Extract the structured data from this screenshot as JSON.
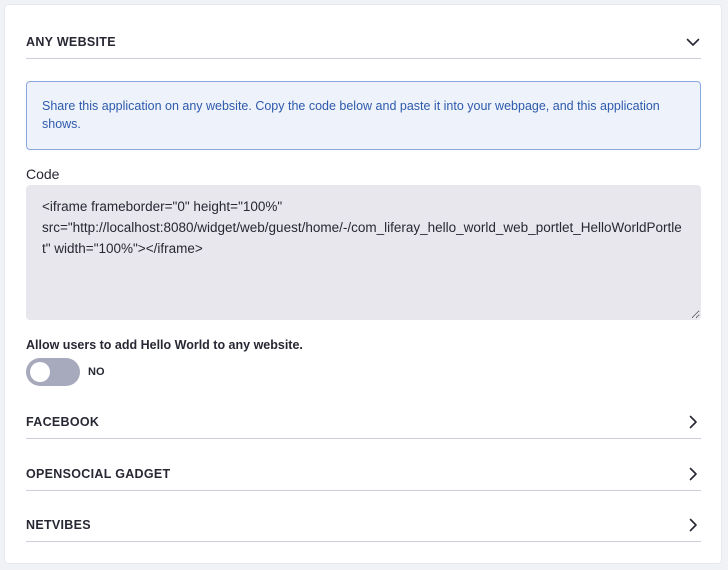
{
  "panels": {
    "any_website": {
      "title": "ANY WEBSITE",
      "icon": "chevron-down-icon",
      "expanded": true
    },
    "facebook": {
      "title": "FACEBOOK",
      "icon": "chevron-right-icon"
    },
    "opensocial": {
      "title": "OPENSOCIAL GADGET",
      "icon": "chevron-right-icon"
    },
    "netvibes": {
      "title": "NETVIBES",
      "icon": "chevron-right-icon"
    }
  },
  "alert": {
    "text": "Share this application on any website. Copy the code below and paste it into your webpage, and this application shows."
  },
  "code": {
    "label": "Code",
    "value": "<iframe frameborder=\"0\" height=\"100%\" src=\"http://localhost:8080/widget/web/guest/home/-/com_liferay_hello_world_web_portlet_HelloWorldPortlet\" width=\"100%\"></iframe>"
  },
  "toggle": {
    "label": "Allow users to add Hello World to any website.",
    "state_label": "NO",
    "on": false
  },
  "colors": {
    "alert_background": "#eef2fa",
    "alert_border": "#89a7e0",
    "alert_text": "#2e5aac",
    "toggle_off": "#a7a9bc"
  }
}
